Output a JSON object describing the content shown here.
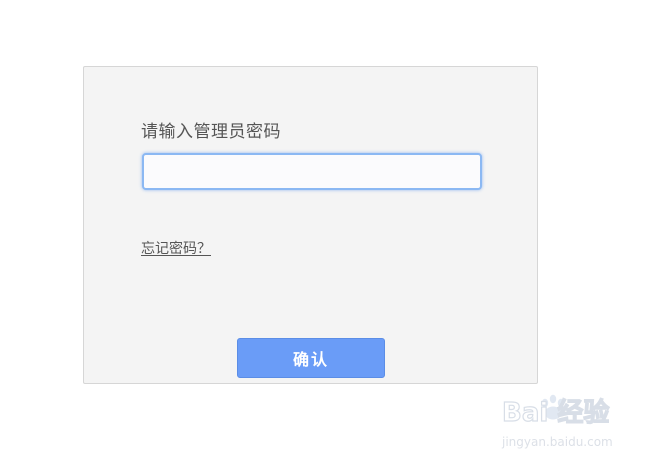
{
  "login": {
    "prompt_label": "请输入管理员密码",
    "password_value": "",
    "forgot_link": "忘记密码？",
    "confirm_button": "确认"
  },
  "watermark": {
    "brand_text": "Bai 经验",
    "site_text": "jingyan.baidu.com"
  },
  "colors": {
    "card_background": "#f4f4f4",
    "input_focus_border": "#8bb8f3",
    "button_background": "#6a9cf7"
  }
}
